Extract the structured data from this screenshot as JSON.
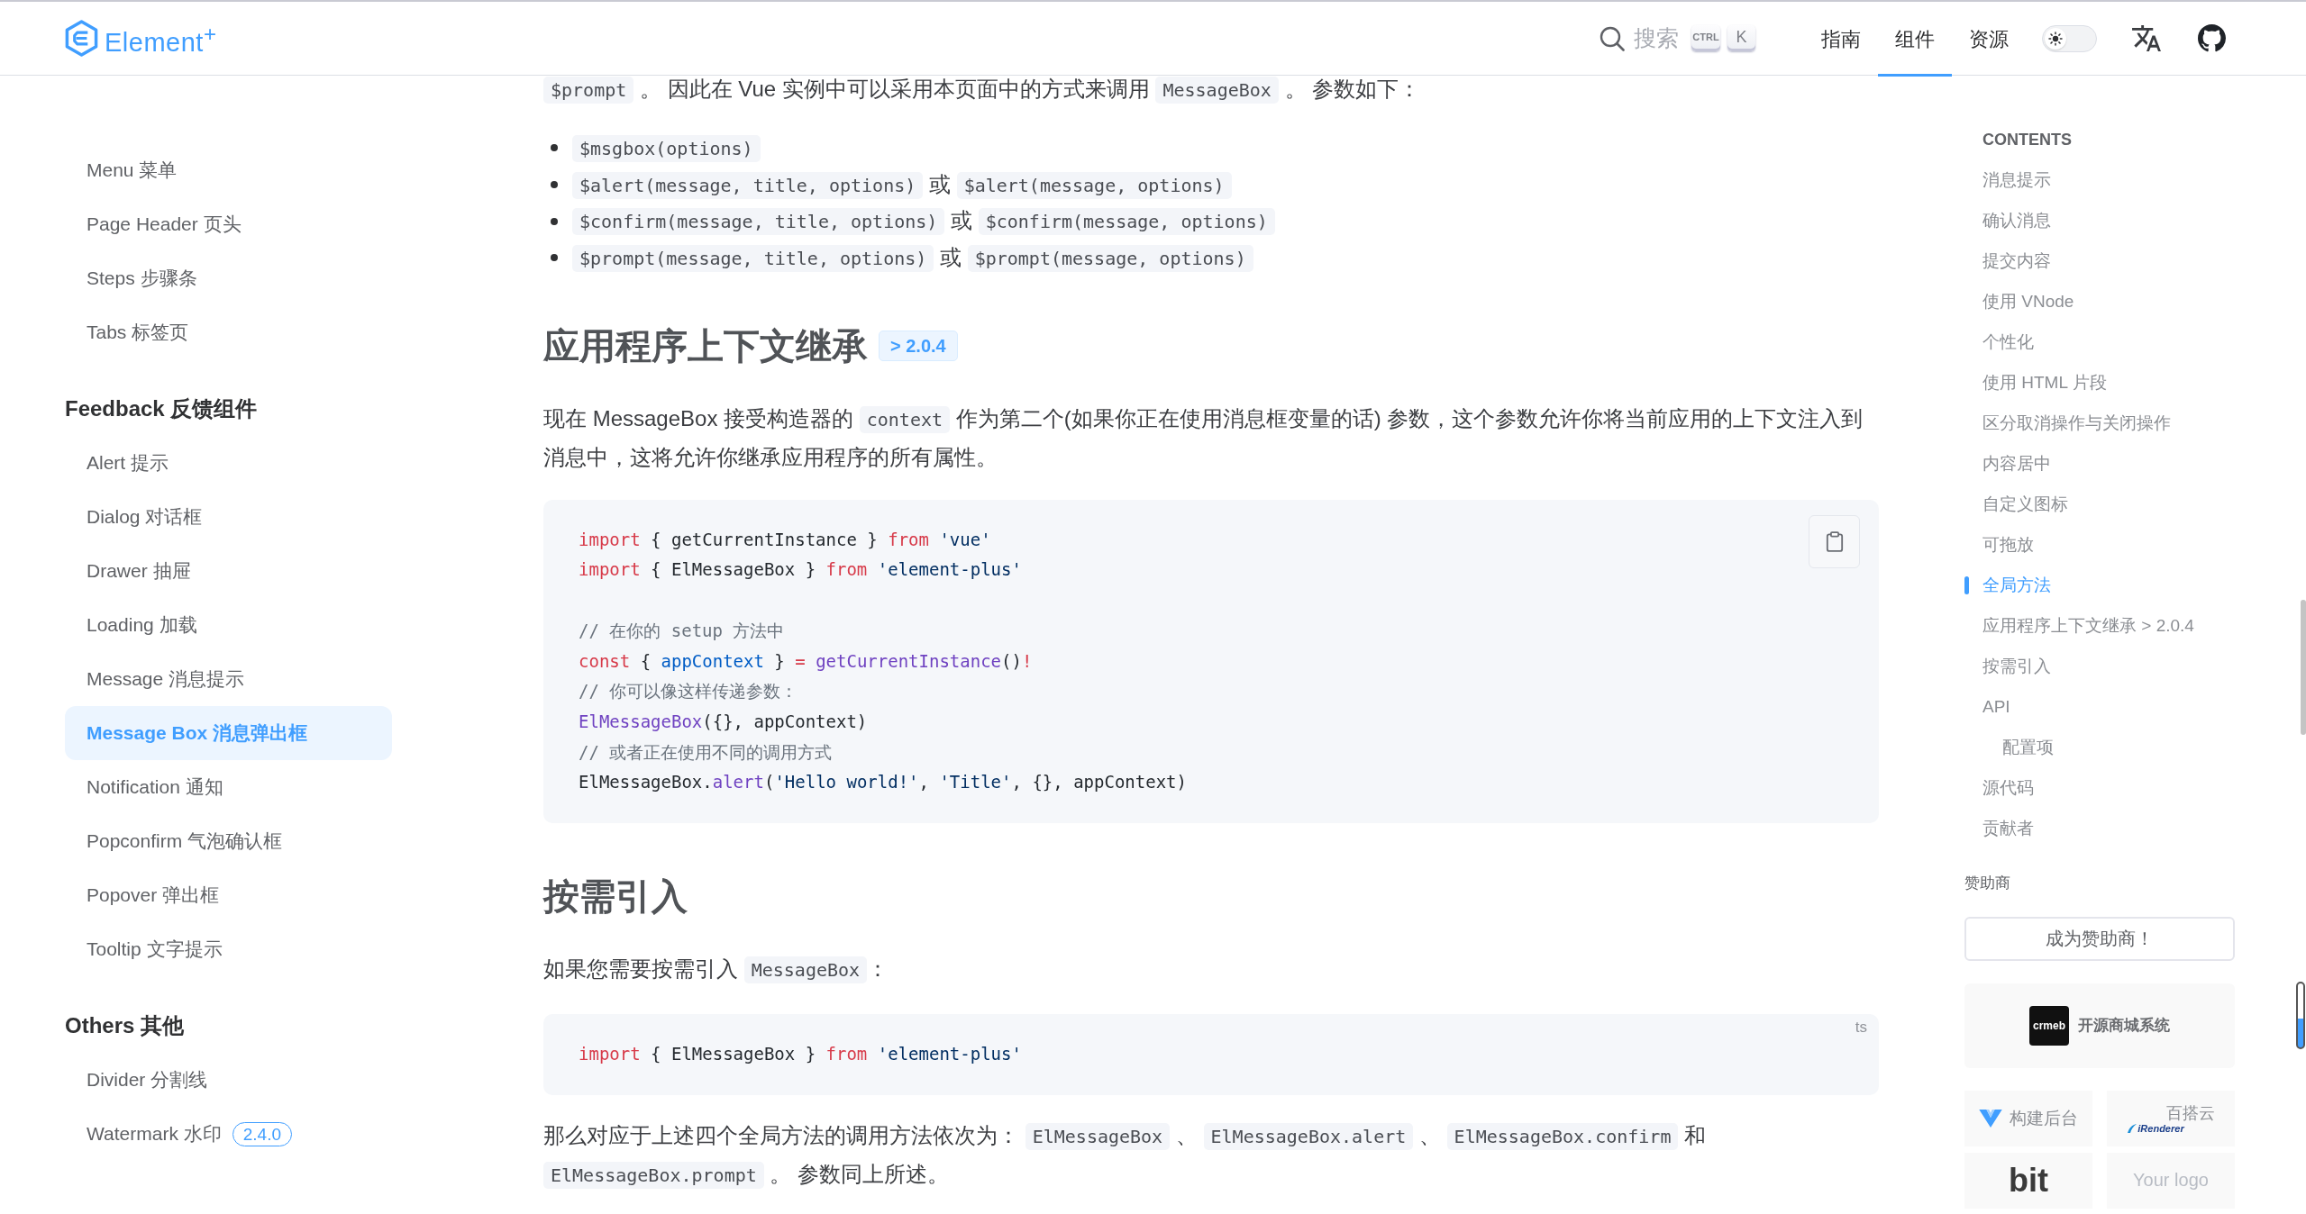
{
  "header": {
    "logo": {
      "text": "Element$^{+}$"
    },
    "search": {
      "placeholder": "搜索",
      "keys": [
        "CTRL",
        "K"
      ]
    },
    "nav": [
      {
        "label": "指南",
        "selected": false
      },
      {
        "label": "组件",
        "selected": true
      },
      {
        "label": "资源",
        "selected": false
      }
    ],
    "theme_switch": {
      "on": false
    }
  },
  "sidebar": {
    "groups": [
      {
        "items": [
          {
            "label": "Menu 菜单",
            "selected": false
          },
          {
            "label": "Page Header 页头",
            "selected": false
          },
          {
            "label": "Steps 步骤条",
            "selected": false
          },
          {
            "label": "Tabs 标签页",
            "selected": false
          }
        ]
      },
      {
        "title": "Feedback 反馈组件",
        "items": [
          {
            "label": "Alert 提示",
            "selected": false
          },
          {
            "label": "Dialog 对话框",
            "selected": false
          },
          {
            "label": "Drawer 抽屉",
            "selected": false
          },
          {
            "label": "Loading 加载",
            "selected": false
          },
          {
            "label": "Message 消息提示",
            "selected": false
          },
          {
            "label": "Message Box 消息弹出框",
            "selected": true
          },
          {
            "label": "Notification 通知",
            "selected": false
          },
          {
            "label": "Popconfirm 气泡确认框",
            "selected": false
          },
          {
            "label": "Popover 弹出框",
            "selected": false
          },
          {
            "label": "Tooltip 文字提示",
            "selected": false
          }
        ]
      },
      {
        "title": "Others 其他",
        "items": [
          {
            "label": "Divider 分割线",
            "selected": false
          },
          {
            "label": "Watermark 水印",
            "selected": false,
            "badge": "2.4.0"
          }
        ]
      }
    ]
  },
  "content": {
    "blocks": [
      {
        "kind": "paragraph",
        "segments": [
          {
            "kind": "code",
            "text": "$prompt"
          },
          {
            "kind": "text",
            "text": " 。 因此在 Vue 实例中可以采用本页面中的方式来调用 "
          },
          {
            "kind": "code",
            "text": "MessageBox"
          },
          {
            "kind": "text",
            "text": " 。 参数如下："
          }
        ]
      },
      {
        "kind": "list",
        "items": [
          {
            "segments": [
              {
                "kind": "code",
                "text": "$msgbox(options)"
              }
            ]
          },
          {
            "segments": [
              {
                "kind": "code",
                "text": "$alert(message, title, options)"
              },
              {
                "kind": "text",
                "text": " 或 "
              },
              {
                "kind": "code",
                "text": "$alert(message, options)"
              }
            ]
          },
          {
            "segments": [
              {
                "kind": "code",
                "text": "$confirm(message, title, options)"
              },
              {
                "kind": "text",
                "text": " 或 "
              },
              {
                "kind": "code",
                "text": "$confirm(message, options)"
              }
            ]
          },
          {
            "segments": [
              {
                "kind": "code",
                "text": "$prompt(message, title, options)"
              },
              {
                "kind": "text",
                "text": " 或 "
              },
              {
                "kind": "code",
                "text": "$prompt(message, options)"
              }
            ]
          }
        ]
      },
      {
        "kind": "heading",
        "text": "应用程序上下文继承",
        "badge": "> 2.0.4"
      },
      {
        "kind": "paragraph",
        "segments": [
          {
            "kind": "text",
            "text": "现在 MessageBox 接受构造器的 "
          },
          {
            "kind": "code",
            "text": "context"
          },
          {
            "kind": "text",
            "text": " 作为第二个(如果你正在使用消息框变量的话) 参数，这个参数允许你将当前应用的上下文注入到消息中，这将允许你继承应用程序的所有属性。"
          }
        ]
      },
      {
        "kind": "code",
        "copy_button": true,
        "sections": [
          {
            "lines": [
              {
                "tokens": [
                  {
                    "kind": "keyword",
                    "text": "import"
                  },
                  {
                    "kind": "plain",
                    "text": " { getCurrentInstance } "
                  },
                  {
                    "kind": "keyword",
                    "text": "from"
                  },
                  {
                    "kind": "string",
                    "text": " 'vue'"
                  }
                ]
              },
              {
                "tokens": [
                  {
                    "kind": "keyword",
                    "text": "import"
                  },
                  {
                    "kind": "plain",
                    "text": " { ElMessageBox } "
                  },
                  {
                    "kind": "keyword",
                    "text": "from"
                  },
                  {
                    "kind": "string",
                    "text": " 'element-plus'"
                  }
                ]
              }
            ]
          },
          {
            "lines": [
              {
                "tokens": [
                  {
                    "kind": "comment",
                    "text": "// 在你的 setup 方法中"
                  }
                ]
              },
              {
                "tokens": [
                  {
                    "kind": "keyword",
                    "text": "const"
                  },
                  {
                    "kind": "plain",
                    "text": " { "
                  },
                  {
                    "kind": "variable",
                    "text": "appContext"
                  },
                  {
                    "kind": "plain",
                    "text": " } "
                  },
                  {
                    "kind": "keyword",
                    "text": "="
                  },
                  {
                    "kind": "function",
                    "text": " getCurrentInstance"
                  },
                  {
                    "kind": "plain",
                    "text": "()"
                  },
                  {
                    "kind": "keyword",
                    "text": "!"
                  }
                ]
              },
              {
                "tokens": [
                  {
                    "kind": "comment",
                    "text": "// 你可以像这样传递参数："
                  }
                ]
              },
              {
                "tokens": [
                  {
                    "kind": "function",
                    "text": "ElMessageBox"
                  },
                  {
                    "kind": "plain",
                    "text": "({}, appContext)"
                  }
                ]
              },
              {
                "tokens": [
                  {
                    "kind": "comment",
                    "text": "// 或者正在使用不同的调用方式"
                  }
                ]
              },
              {
                "tokens": [
                  {
                    "kind": "plain",
                    "text": "ElMessageBox."
                  },
                  {
                    "kind": "function",
                    "text": "alert"
                  },
                  {
                    "kind": "plain",
                    "text": "("
                  },
                  {
                    "kind": "string",
                    "text": "'Hello world!'"
                  },
                  {
                    "kind": "plain",
                    "text": ", "
                  },
                  {
                    "kind": "string",
                    "text": "'Title'"
                  },
                  {
                    "kind": "plain",
                    "text": ", {}, appContext)"
                  }
                ]
              }
            ]
          }
        ]
      },
      {
        "kind": "heading",
        "text": "按需引入"
      },
      {
        "kind": "paragraph",
        "segments": [
          {
            "kind": "text",
            "text": "如果您需要按需引入 "
          },
          {
            "kind": "code",
            "text": "MessageBox"
          },
          {
            "kind": "text",
            "text": "："
          }
        ]
      },
      {
        "kind": "code",
        "lang": "ts",
        "sections": [
          {
            "lines": [
              {
                "tokens": [
                  {
                    "kind": "keyword",
                    "text": "import"
                  },
                  {
                    "kind": "plain",
                    "text": " { ElMessageBox } "
                  },
                  {
                    "kind": "keyword",
                    "text": "from"
                  },
                  {
                    "kind": "string",
                    "text": " 'element-plus'"
                  }
                ]
              }
            ]
          }
        ]
      },
      {
        "kind": "paragraph",
        "segments": [
          {
            "kind": "text",
            "text": "那么对应于上述四个全局方法的调用方法依次为： "
          },
          {
            "kind": "code",
            "text": "ElMessageBox"
          },
          {
            "kind": "text",
            "text": " 、 "
          },
          {
            "kind": "code",
            "text": "ElMessageBox.alert"
          },
          {
            "kind": "text",
            "text": " 、 "
          },
          {
            "kind": "code",
            "text": "ElMessageBox.confirm"
          },
          {
            "kind": "text",
            "text": " 和 "
          },
          {
            "kind": "code",
            "text": "ElMessageBox.prompt"
          },
          {
            "kind": "text",
            "text": " 。 参数同上所述。"
          }
        ]
      }
    ]
  },
  "toc": {
    "title": "CONTENTS",
    "items": [
      {
        "label": "消息提示",
        "selected": false
      },
      {
        "label": "确认消息",
        "selected": false
      },
      {
        "label": "提交内容",
        "selected": false
      },
      {
        "label": "使用 VNode",
        "selected": false
      },
      {
        "label": "个性化",
        "selected": false
      },
      {
        "label": "使用 HTML 片段",
        "selected": false
      },
      {
        "label": "区分取消操作与关闭操作",
        "selected": false
      },
      {
        "label": "内容居中",
        "selected": false
      },
      {
        "label": "自定义图标",
        "selected": false
      },
      {
        "label": "可拖放",
        "selected": false
      },
      {
        "label": "全局方法",
        "selected": true
      },
      {
        "label": "应用程序上下文继承 > 2.0.4",
        "selected": false
      },
      {
        "label": "按需引入",
        "selected": false
      },
      {
        "label": "API",
        "selected": false,
        "children": [
          {
            "label": "配置项",
            "selected": false
          }
        ]
      },
      {
        "label": "源代码",
        "selected": false
      },
      {
        "label": "贡献者",
        "selected": false
      }
    ]
  },
  "sponsors": {
    "title": "赞助商",
    "button": "成为赞助商！",
    "featured": {
      "logo_text": "crmeb",
      "name": "开源商城系统"
    },
    "tiles": [
      {
        "kind": "mark",
        "text": "构建后台"
      },
      {
        "kind": "stacked",
        "text": "百搭云",
        "logo_text": "iRenderer"
      },
      {
        "kind": "wordmark",
        "text": "bit"
      },
      {
        "kind": "placeholder",
        "text": "Your logo"
      }
    ]
  }
}
